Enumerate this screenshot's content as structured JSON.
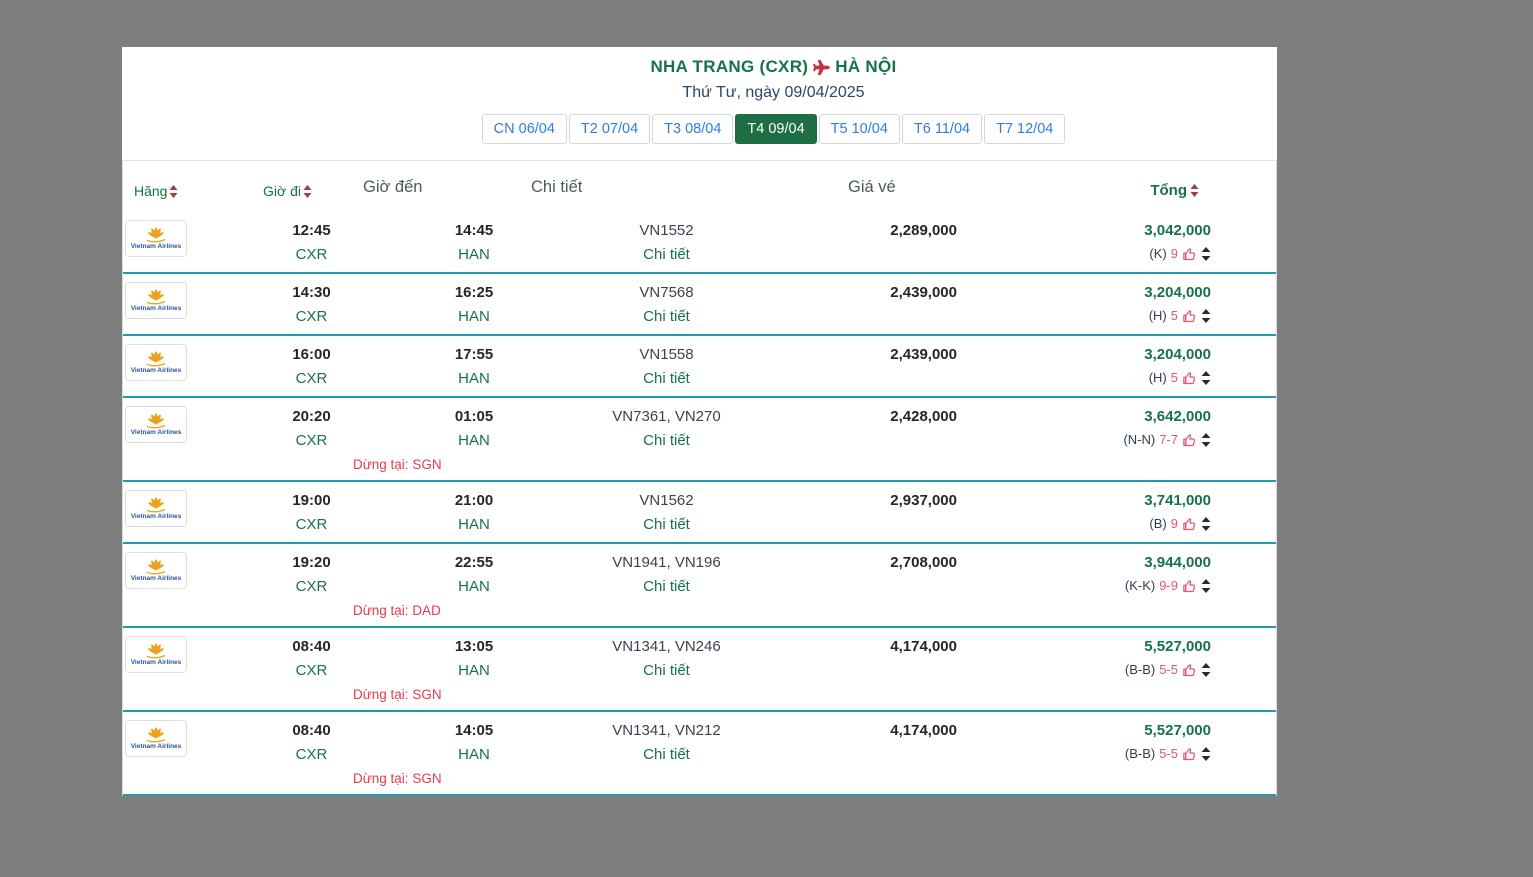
{
  "header": {
    "route_from": "NHA TRANG (CXR)",
    "route_to": "HÀ NỘI",
    "date_line": "Thứ Tư, ngày 09/04/2025"
  },
  "tabs": [
    {
      "label": "CN 06/04",
      "selected": false
    },
    {
      "label": "T2 07/04",
      "selected": false
    },
    {
      "label": "T3 08/04",
      "selected": false
    },
    {
      "label": "T4 09/04",
      "selected": true
    },
    {
      "label": "T5 10/04",
      "selected": false
    },
    {
      "label": "T6 11/04",
      "selected": false
    },
    {
      "label": "T7 12/04",
      "selected": false
    }
  ],
  "table": {
    "headers": {
      "airline": "Hãng",
      "departure": "Giờ đi",
      "arrival": "Giờ đến",
      "details": "Chi tiết",
      "price": "Giá vé",
      "total": "Tổng"
    },
    "rows": [
      {
        "airline": "Vietnam Airlines",
        "dep_time": "12:45",
        "dep_code": "CXR",
        "arr_time": "14:45",
        "arr_code": "HAN",
        "flight": "VN1552",
        "details_label": "Chi tiết",
        "price": "2,289,000",
        "total": "3,042,000",
        "fare_class": "(K)",
        "seats": "9",
        "stop": ""
      },
      {
        "airline": "Vietnam Airlines",
        "dep_time": "14:30",
        "dep_code": "CXR",
        "arr_time": "16:25",
        "arr_code": "HAN",
        "flight": "VN7568",
        "details_label": "Chi tiết",
        "price": "2,439,000",
        "total": "3,204,000",
        "fare_class": "(H)",
        "seats": "5",
        "stop": ""
      },
      {
        "airline": "Vietnam Airlines",
        "dep_time": "16:00",
        "dep_code": "CXR",
        "arr_time": "17:55",
        "arr_code": "HAN",
        "flight": "VN1558",
        "details_label": "Chi tiết",
        "price": "2,439,000",
        "total": "3,204,000",
        "fare_class": "(H)",
        "seats": "5",
        "stop": ""
      },
      {
        "airline": "Vietnam Airlines",
        "dep_time": "20:20",
        "dep_code": "CXR",
        "arr_time": "01:05",
        "arr_code": "HAN",
        "flight": "VN7361, VN270",
        "details_label": "Chi tiết",
        "price": "2,428,000",
        "total": "3,642,000",
        "fare_class": "(N-N)",
        "seats": "7-7",
        "stop": "Dừng tại: SGN"
      },
      {
        "airline": "Vietnam Airlines",
        "dep_time": "19:00",
        "dep_code": "CXR",
        "arr_time": "21:00",
        "arr_code": "HAN",
        "flight": "VN1562",
        "details_label": "Chi tiết",
        "price": "2,937,000",
        "total": "3,741,000",
        "fare_class": "(B)",
        "seats": "9",
        "stop": ""
      },
      {
        "airline": "Vietnam Airlines",
        "dep_time": "19:20",
        "dep_code": "CXR",
        "arr_time": "22:55",
        "arr_code": "HAN",
        "flight": "VN1941, VN196",
        "details_label": "Chi tiết",
        "price": "2,708,000",
        "total": "3,944,000",
        "fare_class": "(K-K)",
        "seats": "9-9",
        "stop": "Dừng tại: DAD"
      },
      {
        "airline": "Vietnam Airlines",
        "dep_time": "08:40",
        "dep_code": "CXR",
        "arr_time": "13:05",
        "arr_code": "HAN",
        "flight": "VN1341, VN246",
        "details_label": "Chi tiết",
        "price": "4,174,000",
        "total": "5,527,000",
        "fare_class": "(B-B)",
        "seats": "5-5",
        "stop": "Dừng tại: SGN"
      },
      {
        "airline": "Vietnam Airlines",
        "dep_time": "08:40",
        "dep_code": "CXR",
        "arr_time": "14:05",
        "arr_code": "HAN",
        "flight": "VN1341, VN212",
        "details_label": "Chi tiết",
        "price": "4,174,000",
        "total": "5,527,000",
        "fare_class": "(B-B)",
        "seats": "5-5",
        "stop": "Dừng tại: SGN"
      }
    ]
  },
  "icons": {
    "plane": "plane-right",
    "sort": "up-down-triangles",
    "thumbs_up": "thumbs-up-outline",
    "stepper": "up-down-stepper",
    "airline_logo": "golden-lotus"
  },
  "colors": {
    "page_background": "#7e7e7e",
    "accent_green": "#157347",
    "selected_tab_green": "#1d6e45",
    "tab_blue": "#2e7ce4",
    "row_separator_teal": "#2199ae",
    "stop_red": "#e23b4f",
    "seats_red": "#e4566e",
    "subtitle_navy": "#29456e"
  }
}
